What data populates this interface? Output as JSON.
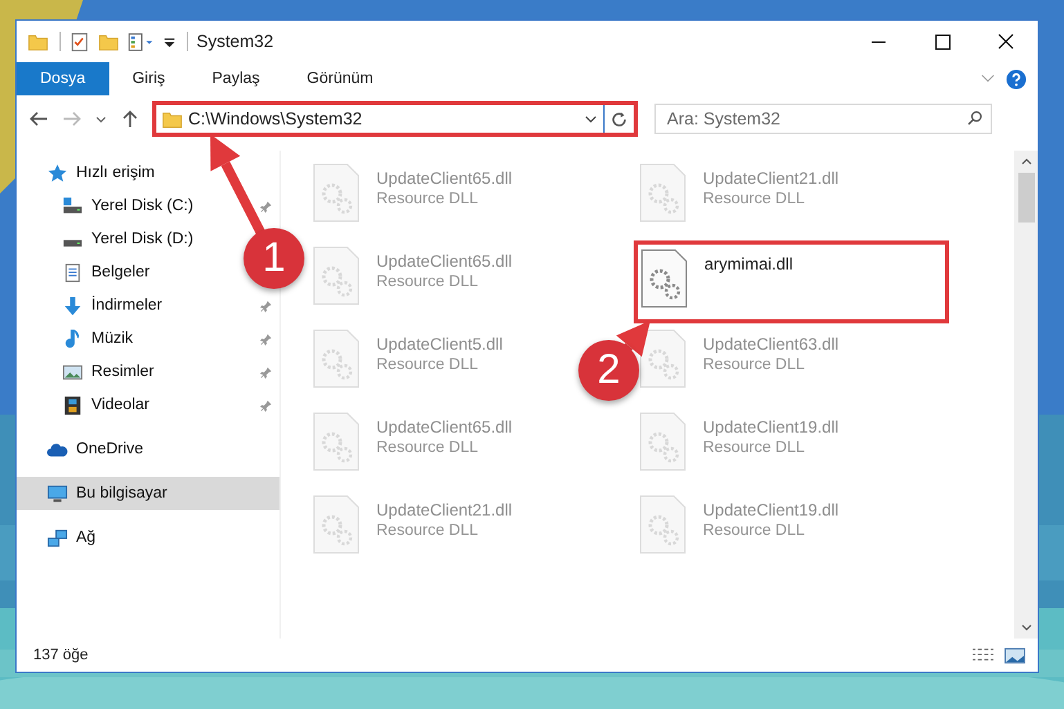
{
  "window": {
    "title": "System32"
  },
  "ribbon_tabs": [
    {
      "label": "Dosya",
      "selected": true
    },
    {
      "label": "Giriş",
      "selected": false
    },
    {
      "label": "Paylaş",
      "selected": false
    },
    {
      "label": "Görünüm",
      "selected": false
    }
  ],
  "address": {
    "value": "C:\\Windows\\System32",
    "highlighted": true
  },
  "search": {
    "placeholder": "Ara: System32"
  },
  "sidebar": {
    "items": [
      {
        "label": "Hızlı erişim",
        "kind": "star",
        "selected": false,
        "children": [
          {
            "label": "Yerel Disk (C:)",
            "kind": "disk-c",
            "pinned": true,
            "selected": false
          },
          {
            "label": "Yerel Disk (D:)",
            "kind": "disk",
            "pinned": false,
            "selected": false
          },
          {
            "label": "Belgeler",
            "kind": "docs",
            "pinned": false,
            "selected": false
          },
          {
            "label": "İndirmeler",
            "kind": "download",
            "pinned": true,
            "selected": false
          },
          {
            "label": "Müzik",
            "kind": "music",
            "pinned": true,
            "selected": false
          },
          {
            "label": "Resimler",
            "kind": "pictures",
            "pinned": true,
            "selected": false
          },
          {
            "label": "Videolar",
            "kind": "videos",
            "pinned": true,
            "selected": false
          }
        ]
      },
      {
        "label": "OneDrive",
        "kind": "cloud",
        "selected": false
      },
      {
        "label": "Bu bilgisayar",
        "kind": "pc",
        "selected": true
      },
      {
        "label": "Ağ",
        "kind": "network",
        "selected": false
      }
    ]
  },
  "files": [
    {
      "name": "UpdateClient65.dll",
      "type": "Resource DLL",
      "highlighted": false
    },
    {
      "name": "UpdateClient21.dll",
      "type": "Resource DLL",
      "highlighted": false
    },
    {
      "name": "UpdateClient65.dll",
      "type": "Resource DLL",
      "highlighted": false
    },
    {
      "name": "arymimai.dll",
      "highlighted": true
    },
    {
      "name": "UpdateClient5.dll",
      "type": "Resource DLL",
      "highlighted": false
    },
    {
      "name": "UpdateClient63.dll",
      "type": "Resource DLL",
      "highlighted": false
    },
    {
      "name": "UpdateClient65.dll",
      "type": "Resource DLL",
      "highlighted": false
    },
    {
      "name": "UpdateClient19.dll",
      "type": "Resource DLL",
      "highlighted": false
    },
    {
      "name": "UpdateClient21.dll",
      "type": "Resource DLL",
      "highlighted": false
    },
    {
      "name": "UpdateClient19.dll",
      "type": "Resource DLL",
      "highlighted": false
    }
  ],
  "status_bar": {
    "count": "137 öğe"
  },
  "callouts": [
    {
      "number": "1"
    },
    {
      "number": "2"
    }
  ]
}
